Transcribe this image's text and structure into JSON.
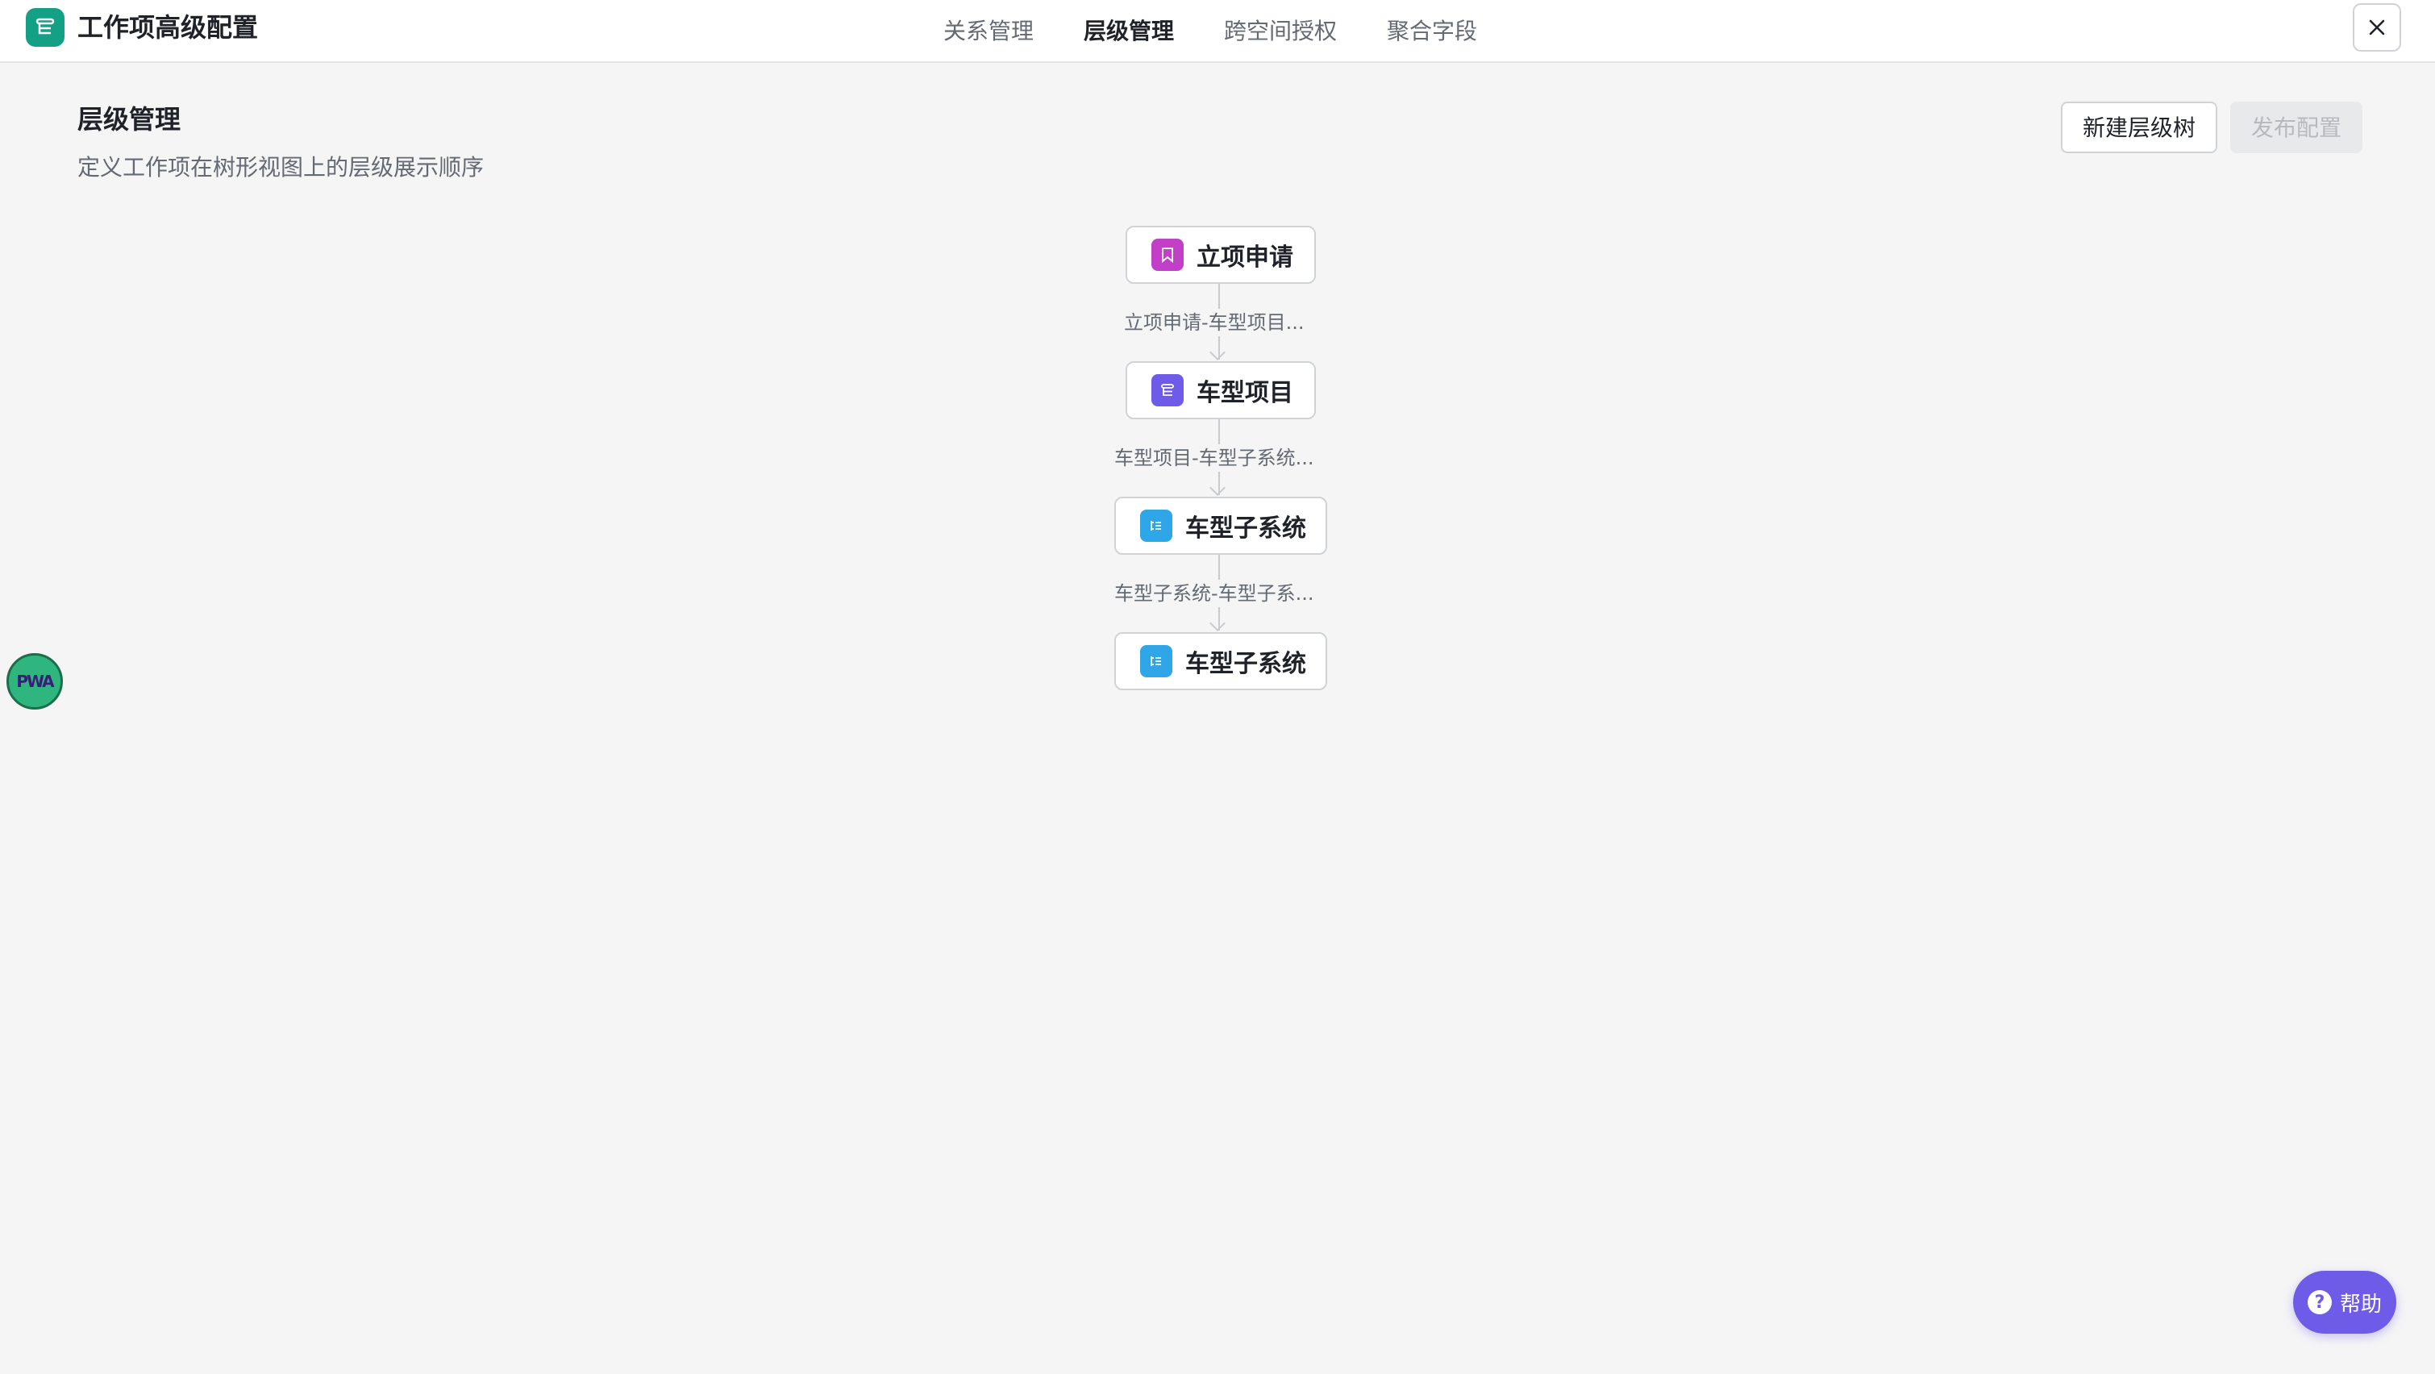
{
  "header": {
    "title": "工作项高级配置",
    "logo_icon": "hierarchy-icon",
    "tabs": [
      {
        "label": "关系管理",
        "active": false
      },
      {
        "label": "层级管理",
        "active": true
      },
      {
        "label": "跨空间授权",
        "active": false
      },
      {
        "label": "聚合字段",
        "active": false
      }
    ],
    "close_icon": "close-icon"
  },
  "section": {
    "title": "层级管理",
    "description": "定义工作项在树形视图上的层级展示顺序"
  },
  "actions": {
    "new_tree_label": "新建层级树",
    "publish_label": "发布配置",
    "publish_disabled": true
  },
  "tree": {
    "nodes": [
      {
        "label": "立项申请",
        "icon": "bookmark-icon",
        "color": "#c23fc8"
      },
      {
        "label": "车型项目",
        "icon": "hierarchy-icon",
        "color": "#6e5be8"
      },
      {
        "label": "车型子系统",
        "icon": "list-icon",
        "color": "#2ea6e8"
      },
      {
        "label": "车型子系统",
        "icon": "list-icon",
        "color": "#2ea6e8"
      }
    ],
    "edges": [
      {
        "label": "立项申请-车型项目..."
      },
      {
        "label": "车型项目-车型子系统..."
      },
      {
        "label": "车型子系统-车型子系..."
      }
    ]
  },
  "floating": {
    "pwa_label": "PWA",
    "help_label": "帮助"
  },
  "colors": {
    "brand": "#14a085",
    "help": "#6e5be8"
  }
}
